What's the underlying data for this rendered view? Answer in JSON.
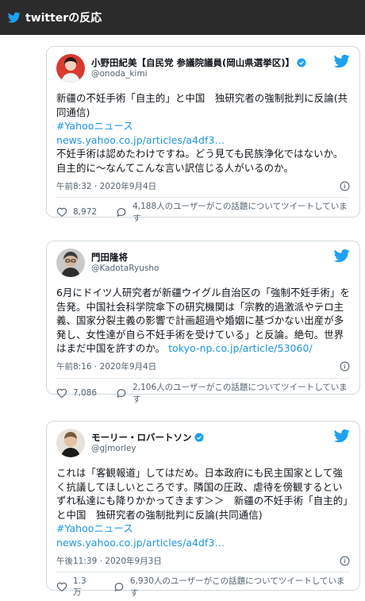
{
  "header": {
    "title": "twitterの反応"
  },
  "colors": {
    "accent": "#1da1f2",
    "link": "#1b95e0",
    "header_bg": "#2b2b2b",
    "verified": "#1da1f2"
  },
  "tweets": [
    {
      "name": "小野田紀美【自民党 参議院議員(岡山県選挙区)】",
      "handle": "@onoda_kimi",
      "verified": true,
      "text1": "新疆の不妊手術「自主的」と中国　独研究者の強制批判に反論(共同通信)",
      "hashtag": "#Yahooニュース",
      "link": "news.yahoo.co.jp/articles/a4df3…",
      "text2": "不妊手術は認めたわけですね。どう見ても民族浄化ではないか。自主的に～なんてこんな言い訳信じる人がいるのか。",
      "time": "午前8:32 · 2020年9月4日",
      "likes": "8,972",
      "replies": "4,188人のユーザーがこの話題についてツイートしています"
    },
    {
      "name": "門田隆将",
      "handle": "@KadotaRyusho",
      "verified": false,
      "text1": "6月にドイツ人研究者が新疆ウイグル自治区の「強制不妊手術」を告発。中国社会科学院傘下の研究機関は「宗教的過激派やテロ主義、国家分裂主義の影響で計画超過や婚姻に基づかない出産が多発し、女性達が自ら不妊手術を受けている」と反論。絶句。世界はまだ中国を許すのか。",
      "link": "tokyo-np.co.jp/article/53060/",
      "time": "午前8:16 · 2020年9月4日",
      "likes": "7,086",
      "replies": "2,106人のユーザーがこの話題についてツイートしています"
    },
    {
      "name": "モーリー・ロバートソン",
      "handle": "@gjmorley",
      "verified": true,
      "text1": "これは「客観報道」してはだめ。日本政府にも民主国家として強く抗議してほしいところです。隣国の圧政、虐待を傍観するといずれ私達にも降りかかってきます＞＞　新疆の不妊手術「自主的」と中国　独研究者の強制批判に反論(共同通信)",
      "hashtag": "#Yahooニュース",
      "link": "news.yahoo.co.jp/articles/a4df3…",
      "time": "午後11:39 · 2020年9月3日",
      "likes": "1.3万",
      "replies": "6,930人のユーザーがこの話題についてツイートしています"
    }
  ]
}
